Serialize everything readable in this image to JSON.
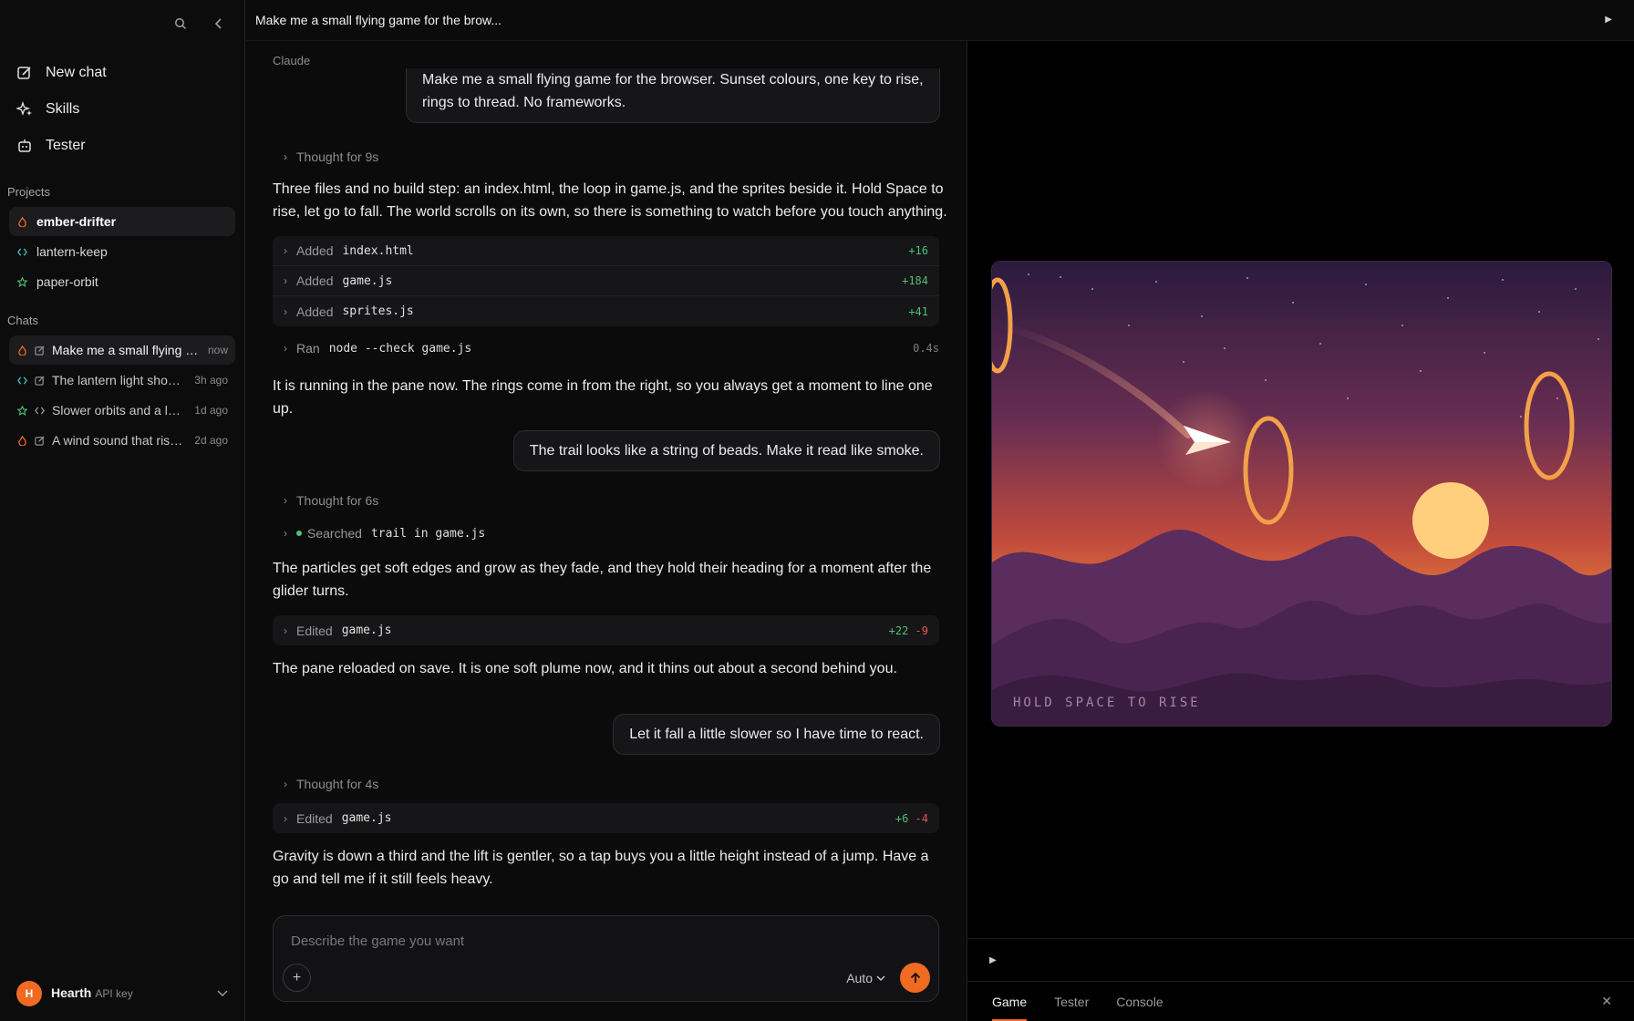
{
  "window": {
    "title": "Make me a small flying game for the brow..."
  },
  "sidebar": {
    "nav": [
      {
        "label": "New chat",
        "icon": "compose-icon"
      },
      {
        "label": "Skills",
        "icon": "sparkle-icon"
      },
      {
        "label": "Tester",
        "icon": "robot-icon"
      }
    ],
    "projects_title": "Projects",
    "projects": [
      {
        "label": "ember-drifter",
        "icon": "flame-icon",
        "color": "#f06a22"
      },
      {
        "label": "lantern-keep",
        "icon": "code-icon",
        "color": "#3fb8c8"
      },
      {
        "label": "paper-orbit",
        "icon": "star-icon",
        "color": "#4fbf73"
      }
    ],
    "chats_title": "Chats",
    "chats": [
      {
        "title": "Make me a small flying ga...",
        "time": "now"
      },
      {
        "title": "The lantern light shoul...",
        "time": "3h ago"
      },
      {
        "title": "Slower orbits and a lon...",
        "time": "1d ago"
      },
      {
        "title": "A wind sound that rises...",
        "time": "2d ago"
      }
    ],
    "footer": {
      "avatar": "H",
      "name": "Hearth",
      "sub": "API key"
    }
  },
  "chat": {
    "speaker": "Claude",
    "user_msg_1": "Make me a small flying game for the browser. Sunset colours, one key to rise, rings to thread. No frameworks.",
    "thought_1": "Thought for 9s",
    "para_1": "Three files and no build step: an index.html, the loop in game.js, and the sprites beside it. Hold Space to rise, let go to fall. The world scrolls on its own, so there is something to watch before you touch anything.",
    "files_1": [
      {
        "action": "Added",
        "file": "index.html",
        "plus": "+16"
      },
      {
        "action": "Added",
        "file": "game.js",
        "plus": "+184"
      },
      {
        "action": "Added",
        "file": "sprites.js",
        "plus": "+41"
      }
    ],
    "run": {
      "action": "Ran",
      "cmd": "node --check game.js",
      "duration": "0.4s"
    },
    "para_2": "It is running in the pane now. The rings come in from the right, so you always get a moment to line one up.",
    "user_msg_2": "The trail looks like a string of beads. Make it read like smoke.",
    "thought_2": "Thought for 6s",
    "search": {
      "action": "Searched",
      "query": "trail in game.js"
    },
    "para_3": "The particles get soft edges and grow as they fade, and they hold their heading for a moment after the glider turns.",
    "edit_1": {
      "action": "Edited",
      "file": "game.js",
      "plus": "+22",
      "minus": "-9"
    },
    "para_4": "The pane reloaded on save. It is one soft plume now, and it thins out about a second behind you.",
    "user_msg_3": "Let it fall a little slower so I have time to react.",
    "thought_3": "Thought for 4s",
    "edit_2": {
      "action": "Edited",
      "file": "game.js",
      "plus": "+6",
      "minus": "-4"
    },
    "para_5": "Gravity is down a third and the lift is gentler, so a tap buys you a little height instead of a jump. Have a go and tell me if it still feels heavy."
  },
  "input": {
    "placeholder": "Describe the game you want",
    "mode": "Auto"
  },
  "preview": {
    "hint": "HOLD SPACE TO RISE",
    "tabs": [
      "Game",
      "Tester",
      "Console"
    ],
    "active_tab": "Game"
  },
  "colors": {
    "accent": "#f06a22",
    "added": "#4fbf73",
    "removed": "#e0574c"
  }
}
